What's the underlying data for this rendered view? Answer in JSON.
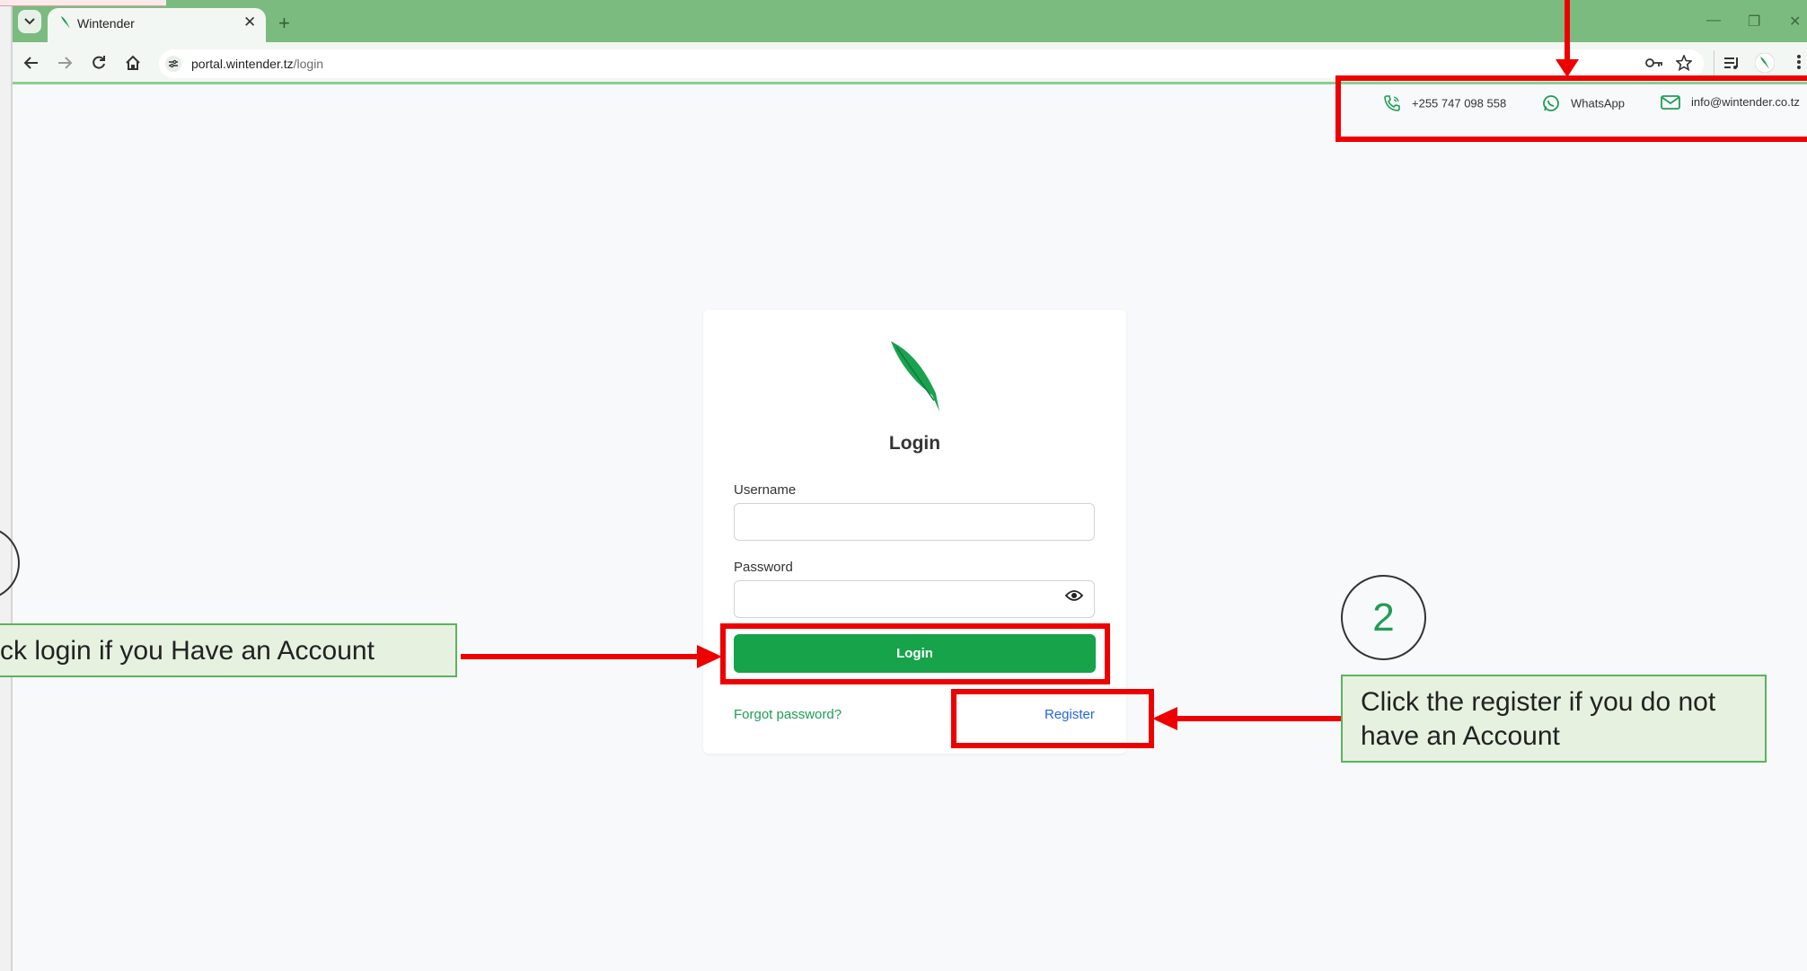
{
  "browser": {
    "tab_title": "Wintender",
    "tab_menu_icon": "chevron-down-icon",
    "close_tab": "✕",
    "new_tab": "+",
    "url_host": "portal.wintender.tz",
    "url_path": "/login",
    "window_controls": [
      "—",
      "❐",
      "✕"
    ]
  },
  "contact": {
    "phone": "+255 747 098 558",
    "whatsapp": "WhatsApp",
    "email": "info@wintender.co.tz"
  },
  "login_form": {
    "title": "Login",
    "username_label": "Username",
    "username_value": "",
    "password_label": "Password",
    "password_value": "",
    "submit_label": "Login",
    "forgot_label": "Forgot password?",
    "register_label": "Register"
  },
  "annotations": {
    "left_callout": "ck login if you Have an Account",
    "right_callout": "Click the register if you do not have an Account",
    "step_number": "2"
  },
  "colors": {
    "brand_green": "#16a34a",
    "annotation_red": "#ee0000",
    "tab_strip": "#7cbb80"
  }
}
